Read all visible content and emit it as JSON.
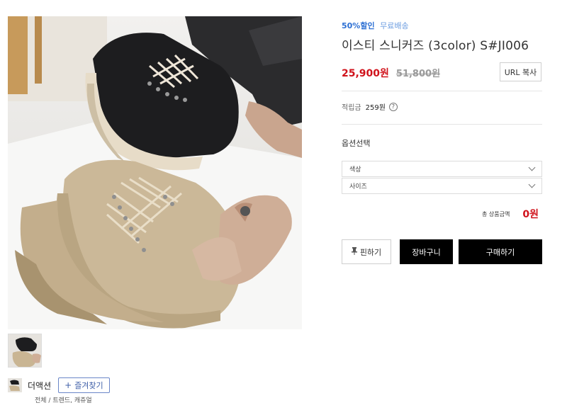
{
  "product": {
    "discount_tag": "50%할인",
    "shipping_tag": "무료배송",
    "title": "이스티 스니커즈 (3color) S#JI006",
    "price": "25,900원",
    "original_price": "51,800원",
    "url_copy_label": "URL 복사",
    "points_label": "적립금",
    "points_value": "259원",
    "points_help": "?"
  },
  "options": {
    "section_title": "옵션선택",
    "selects": [
      {
        "placeholder": "색상"
      },
      {
        "placeholder": "사이즈"
      }
    ],
    "total_label": "총 상품금액",
    "total_value": "0원"
  },
  "actions": {
    "pin_label": "핀하기",
    "pin_icon": "pushpin-icon",
    "cart_label": "장바구니",
    "buy_label": "구매하기"
  },
  "shop": {
    "name": "더액션",
    "favorite_label": "즐겨찾기",
    "favorite_icon": "+",
    "breadcrumb": "전체 / 트렌드, 캐쥬얼"
  },
  "colors": {
    "price_red": "#d0121b",
    "discount_blue": "#2c6fd3",
    "shipping_blue": "#6b9ce0",
    "button_black": "#000000"
  }
}
